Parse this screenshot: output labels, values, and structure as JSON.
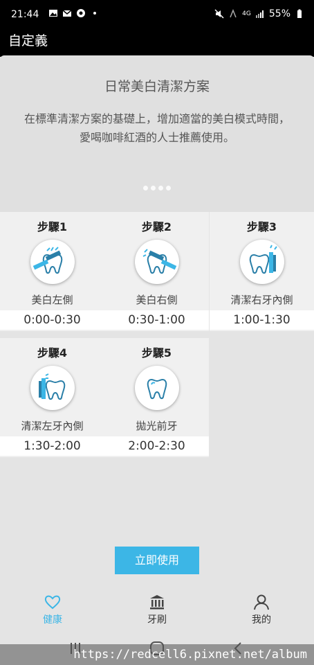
{
  "status_bar": {
    "time": "21:44",
    "network": "4G",
    "battery": "55%"
  },
  "header": {
    "title": "自定義"
  },
  "plan": {
    "title": "日常美白清潔方案",
    "description": "在標準清潔方案的基礎上，增加適當的美白模式時間，愛喝咖啡紅酒的人士推薦使用。"
  },
  "steps": [
    {
      "label": "步驟1",
      "name": "美白左側",
      "time": "0:00-0:30",
      "icon": "brush-left-tooth-icon"
    },
    {
      "label": "步驟2",
      "name": "美白右側",
      "time": "0:30-1:00",
      "icon": "brush-right-tooth-icon"
    },
    {
      "label": "步驟3",
      "name": "清潔右牙內側",
      "time": "1:00-1:30",
      "icon": "brush-inner-right-tooth-icon"
    },
    {
      "label": "步驟4",
      "name": "清潔左牙內側",
      "time": "1:30-2:00",
      "icon": "brush-inner-left-tooth-icon"
    },
    {
      "label": "步驟5",
      "name": "拋光前牙",
      "time": "2:00-2:30",
      "icon": "tooth-polish-icon"
    }
  ],
  "use_button": {
    "label": "立即使用"
  },
  "bottom_nav": [
    {
      "label": "健康",
      "icon": "heart-icon",
      "active": true
    },
    {
      "label": "牙刷",
      "icon": "toothbrush-bank-icon",
      "active": false
    },
    {
      "label": "我的",
      "icon": "user-icon",
      "active": false
    }
  ],
  "colors": {
    "accent": "#3cb6e6",
    "tooth_outline": "#2a7fa8"
  },
  "watermark": {
    "text": "https://redcell6.pixnet.net/album"
  }
}
